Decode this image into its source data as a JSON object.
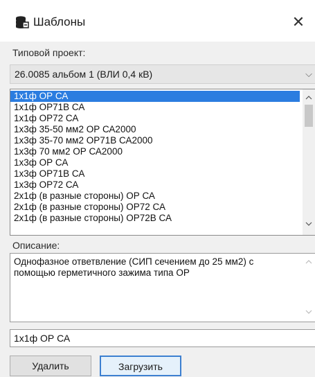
{
  "window": {
    "title": "Шаблоны",
    "close_glyph": "✕"
  },
  "project": {
    "label": "Типовой проект:",
    "selected": "26.0085 альбом 1 (ВЛИ 0,4 кВ)",
    "arrow": "⌵"
  },
  "templates": {
    "items": [
      "1х1ф ОР СА",
      "1х1ф ОР71В СА",
      "1х1ф ОР72 СА",
      "1х3ф 35-50 мм2 ОР СА2000",
      "1х3ф 35-70 мм2 ОР71В СА2000",
      "1х3ф 70 мм2 ОР СА2000",
      "1х3ф ОР СА",
      "1х3ф ОР71В СА",
      "1х3ф ОР72 СА",
      "2х1ф (в разные стороны) ОР СА",
      "2х1ф (в разные стороны) ОР72 СА",
      "2х1ф (в разные стороны) ОР72В СА"
    ],
    "selected_index": 0
  },
  "description": {
    "label": "Описание:",
    "text": "Однофазное ответвление (СИП сечением до 25 мм2) с помощью герметичного зажима типа ОР"
  },
  "name_field": {
    "value": "1х1ф ОР СА"
  },
  "buttons": {
    "delete_label": "Удалить",
    "load_label": "Загрузить"
  },
  "icons": {
    "title": "database-icon",
    "close": "close-icon",
    "scroll_up": "chevron-up-icon",
    "scroll_down": "chevron-down-icon"
  },
  "colors": {
    "selection": "#2b7de0",
    "load_button_border": "#3c7fd0",
    "dialog_bg": "#f0f0f0"
  }
}
